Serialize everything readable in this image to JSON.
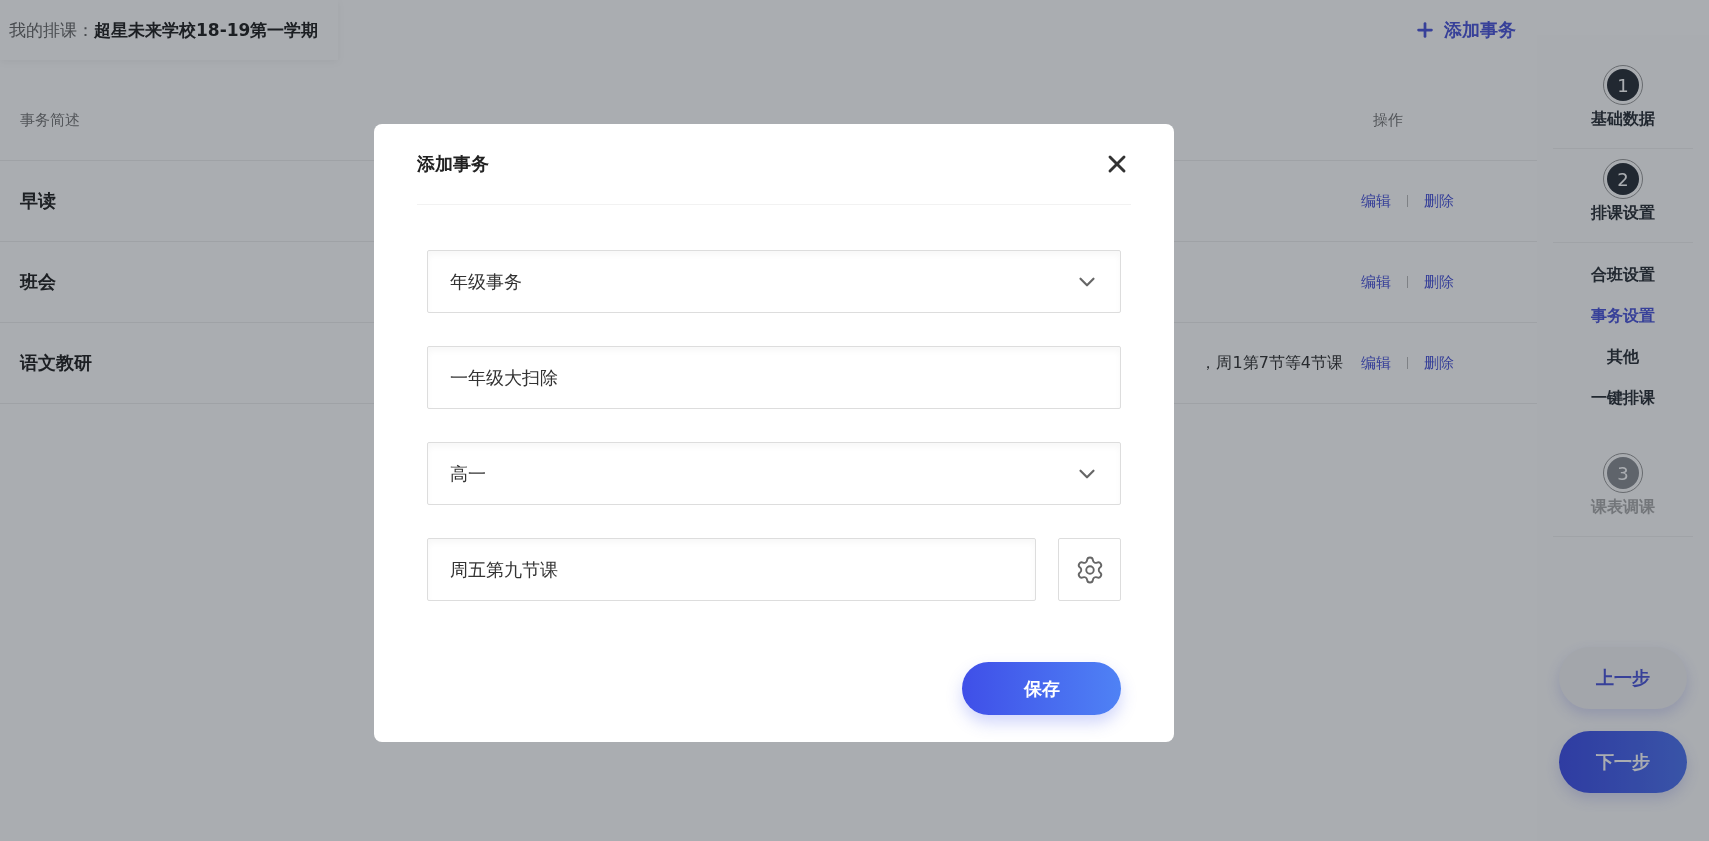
{
  "header": {
    "label": "我的排课：",
    "school": "超星未来学校18-19第一学期",
    "add_button": "添加事务"
  },
  "table": {
    "columns": [
      "事务简述",
      "操作"
    ],
    "rows": [
      {
        "name": "早读",
        "actions": [
          "编辑",
          "删除"
        ]
      },
      {
        "name": "班会",
        "actions": [
          "编辑",
          "删除"
        ]
      },
      {
        "name": "语文教研",
        "time": "，周1第7节等4节课",
        "actions": [
          "编辑",
          "删除"
        ]
      }
    ]
  },
  "sidebar": {
    "steps": [
      {
        "number": "1",
        "label": "基础数据",
        "disabled": false
      },
      {
        "number": "2",
        "label": "排课设置",
        "disabled": false,
        "substeps": [
          {
            "label": "合班设置",
            "selected": false
          },
          {
            "label": "事务设置",
            "selected": true
          },
          {
            "label": "其他",
            "selected": false
          },
          {
            "label": "一键排课",
            "selected": false
          }
        ]
      },
      {
        "number": "3",
        "label": "课表调课",
        "disabled": true
      }
    ],
    "prev_button": "上一步",
    "next_button": "下一步"
  },
  "dialog": {
    "title": "添加事务",
    "fields": [
      {
        "kind": "select",
        "value": "年级事务"
      },
      {
        "kind": "text",
        "value": "一年级大扫除"
      },
      {
        "kind": "select",
        "value": "高一"
      },
      {
        "kind": "picker",
        "value": "周五第九节课"
      }
    ],
    "save_button": "保存"
  }
}
